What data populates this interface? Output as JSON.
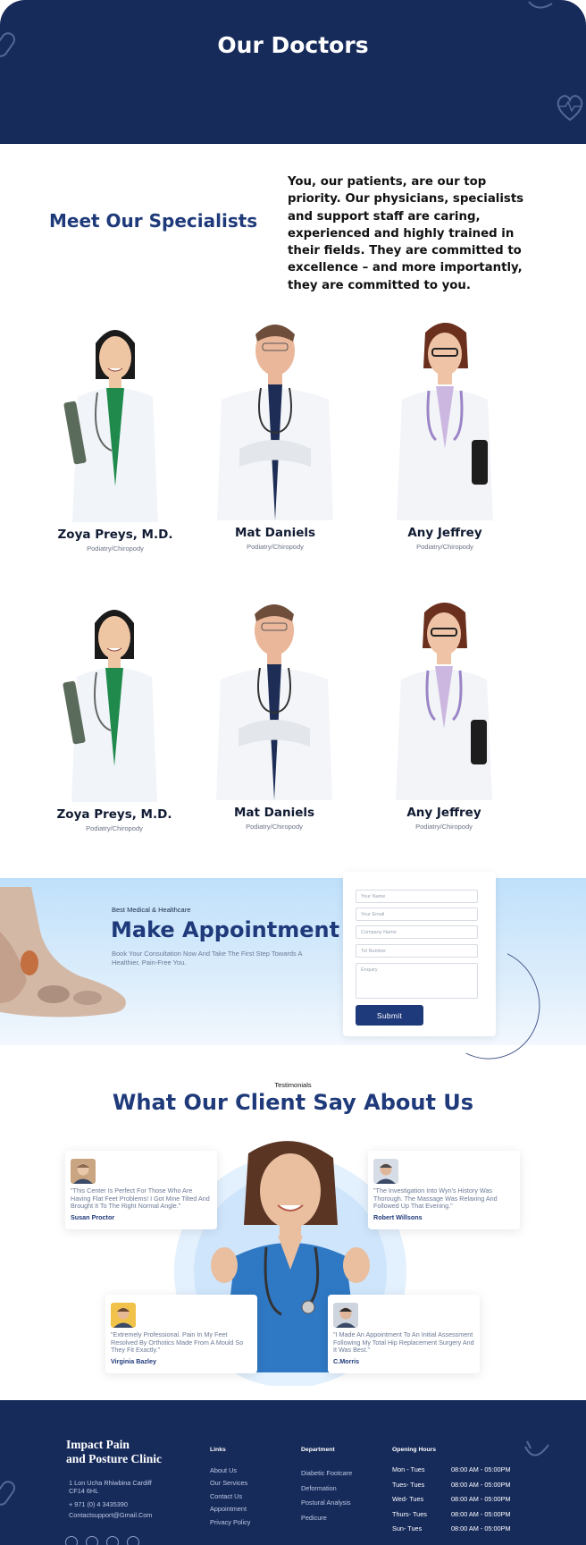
{
  "hero": {
    "title": "Our Doctors"
  },
  "intro": {
    "heading": "Meet Our Specialists",
    "text": "You, our patients, are our top priority. Our physicians, specialists and support staff are caring, experienced and highly trained in their fields. They are committed to excellence – and more importantly, they are committed to you."
  },
  "doctors": [
    {
      "name": "Zoya Preys, M.D.",
      "role": "Podiatry/Chiropody"
    },
    {
      "name": "Mat Daniels",
      "role": "Podiatry/Chiropody"
    },
    {
      "name": "Any Jeffrey",
      "role": "Podiatry/Chiropody"
    },
    {
      "name": "Zoya Preys, M.D.",
      "role": "Podiatry/Chiropody"
    },
    {
      "name": "Mat Daniels",
      "role": "Podiatry/Chiropody"
    },
    {
      "name": "Any Jeffrey",
      "role": "Podiatry/Chiropody"
    }
  ],
  "appointment": {
    "eyebrow": "Best Medical & Healthcare",
    "title": "Make Appointment",
    "subtitle": "Book Your Consultation Now And Take The First Step Towards A Healthier, Pain-Free You.",
    "form": {
      "name_placeholder": "Your Name",
      "email_placeholder": "Your Email",
      "company_placeholder": "Company Name",
      "tel_placeholder": "Tel Number",
      "enquiry_placeholder": "Enquiry",
      "submit": "Submit"
    }
  },
  "testimonials": {
    "label": "Testimonials",
    "title": "What Our Client Say About Us",
    "items": [
      {
        "quote": "\"This Center Is Perfect For Those Who Are Having Flat Feet Problems! I Got Mine Tilted And Brought It To The Right Normal Angle.\"",
        "author": "Susan Proctor"
      },
      {
        "quote": "\"The Investigation Into Wyn's History Was Thorough. The Massage Was Relaxing And Followed Up That Evening.\"",
        "author": "Robert Willsons"
      },
      {
        "quote": "\"Extremely Professional. Pain In My Feet Resolved By Orthotics Made From A Mould So They Fit Exactly.\"",
        "author": "Virginia Bazley"
      },
      {
        "quote": "\"I Made An Appointment To An Initial Assessment Following My Total Hip Replacement Surgery And It Was Best.\"",
        "author": "C.Morris"
      }
    ]
  },
  "footer": {
    "brand_line1": "Impact Pain",
    "brand_line2": "and Posture Clinic",
    "address1": "1 Lon Ucha Rhiwbina Cardiff",
    "address2": "CF14 6HL",
    "phone": "+ 971 (0) 4 3435390",
    "email": "Contactsupport@Gmail.Com",
    "links_heading": "Links",
    "links": [
      "About Us",
      "Our Services",
      "Contact Us",
      "Appointment",
      "Privacy Policy"
    ],
    "dept_heading": "Department",
    "departments": [
      "Diabetic Footcare",
      "Deformation",
      "Postural Analysis",
      "Pedicure"
    ],
    "hours_heading": "Opening Hours",
    "hours": [
      {
        "day": "Mon - Tues",
        "time": "08:00 AM - 05:00PM"
      },
      {
        "day": "Tues- Tues",
        "time": "08:00 AM - 05:00PM"
      },
      {
        "day": "Wed- Tues",
        "time": "08:00 AM - 05:00PM"
      },
      {
        "day": "Thurs- Tues",
        "time": "08:00 AM - 05:00PM"
      },
      {
        "day": "Sun- Tues",
        "time": "08:00 AM - 05:00PM"
      }
    ],
    "social_icons": [
      "facebook-icon",
      "twitter-icon",
      "instagram-icon",
      "pinterest-icon"
    ]
  }
}
